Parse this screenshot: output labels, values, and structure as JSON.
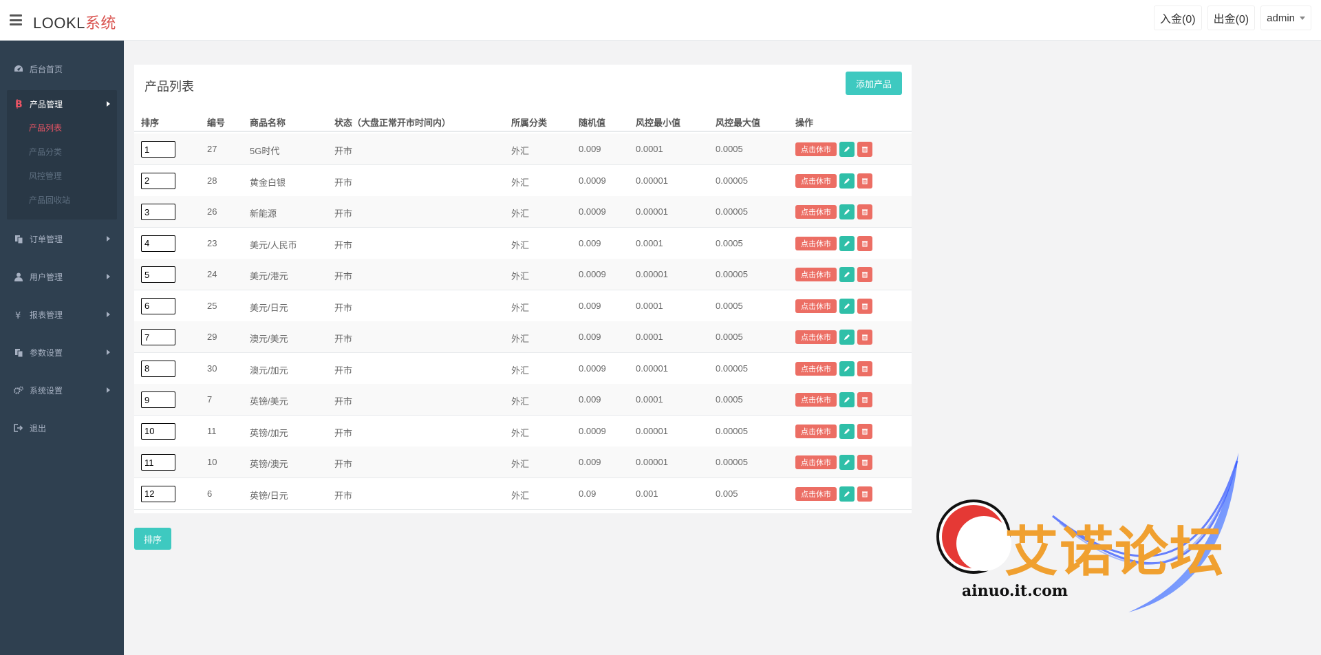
{
  "header": {
    "brand_part1": "LOOKL",
    "brand_part2": "系统",
    "deposit": "入金(0)",
    "withdraw": "出金(0)",
    "user": "admin"
  },
  "sidebar": {
    "items": [
      {
        "label": "后台首页",
        "icon": "dashboard-icon"
      },
      {
        "label": "产品管理",
        "icon": "bitcoin-icon"
      },
      {
        "label": "订单管理",
        "icon": "files-icon"
      },
      {
        "label": "用户管理",
        "icon": "user-icon"
      },
      {
        "label": "报表管理",
        "icon": "yen-icon"
      },
      {
        "label": "参数设置",
        "icon": "files-icon"
      },
      {
        "label": "系统设置",
        "icon": "gears-icon"
      },
      {
        "label": "退出",
        "icon": "sign-out-icon"
      }
    ],
    "sub_items": [
      "产品列表",
      "产品分类",
      "风控管理",
      "产品回收站"
    ]
  },
  "panel": {
    "title": "产品列表",
    "add_button": "添加产品",
    "sort_button": "排序"
  },
  "table": {
    "headers": [
      "排序",
      "编号",
      "商品名称",
      "状态（大盘正常开市时间内）",
      "所属分类",
      "随机值",
      "风控最小值",
      "风控最大值",
      "操作"
    ],
    "action_label": "点击休市",
    "rows": [
      {
        "sort": "1",
        "id": "27",
        "name": "5G时代",
        "status": "开市",
        "category": "外汇",
        "random": "0.009",
        "min": "0.0001",
        "max": "0.0005"
      },
      {
        "sort": "2",
        "id": "28",
        "name": "黄金白银",
        "status": "开市",
        "category": "外汇",
        "random": "0.0009",
        "min": "0.00001",
        "max": "0.00005"
      },
      {
        "sort": "3",
        "id": "26",
        "name": "新能源",
        "status": "开市",
        "category": "外汇",
        "random": "0.0009",
        "min": "0.00001",
        "max": "0.00005"
      },
      {
        "sort": "4",
        "id": "23",
        "name": "美元/人民币",
        "status": "开市",
        "category": "外汇",
        "random": "0.009",
        "min": "0.0001",
        "max": "0.0005"
      },
      {
        "sort": "5",
        "id": "24",
        "name": "美元/港元",
        "status": "开市",
        "category": "外汇",
        "random": "0.0009",
        "min": "0.00001",
        "max": "0.00005"
      },
      {
        "sort": "6",
        "id": "25",
        "name": "美元/日元",
        "status": "开市",
        "category": "外汇",
        "random": "0.009",
        "min": "0.0001",
        "max": "0.0005"
      },
      {
        "sort": "7",
        "id": "29",
        "name": "澳元/美元",
        "status": "开市",
        "category": "外汇",
        "random": "0.009",
        "min": "0.0001",
        "max": "0.0005"
      },
      {
        "sort": "8",
        "id": "30",
        "name": "澳元/加元",
        "status": "开市",
        "category": "外汇",
        "random": "0.0009",
        "min": "0.00001",
        "max": "0.00005"
      },
      {
        "sort": "9",
        "id": "7",
        "name": "英镑/美元",
        "status": "开市",
        "category": "外汇",
        "random": "0.009",
        "min": "0.0001",
        "max": "0.0005"
      },
      {
        "sort": "10",
        "id": "11",
        "name": "英镑/加元",
        "status": "开市",
        "category": "外汇",
        "random": "0.0009",
        "min": "0.00001",
        "max": "0.00005"
      },
      {
        "sort": "11",
        "id": "10",
        "name": "英镑/澳元",
        "status": "开市",
        "category": "外汇",
        "random": "0.009",
        "min": "0.00001",
        "max": "0.00005"
      },
      {
        "sort": "12",
        "id": "6",
        "name": "英镑/日元",
        "status": "开市",
        "category": "外汇",
        "random": "0.09",
        "min": "0.001",
        "max": "0.005"
      }
    ]
  },
  "watermark": {
    "text": "艾诺论坛",
    "url": "ainuo.it.com"
  },
  "colors": {
    "sidebar": "#2f4050",
    "accent": "#3ec9c0",
    "danger": "#ec6e64",
    "active_sub": "#ed5565"
  }
}
